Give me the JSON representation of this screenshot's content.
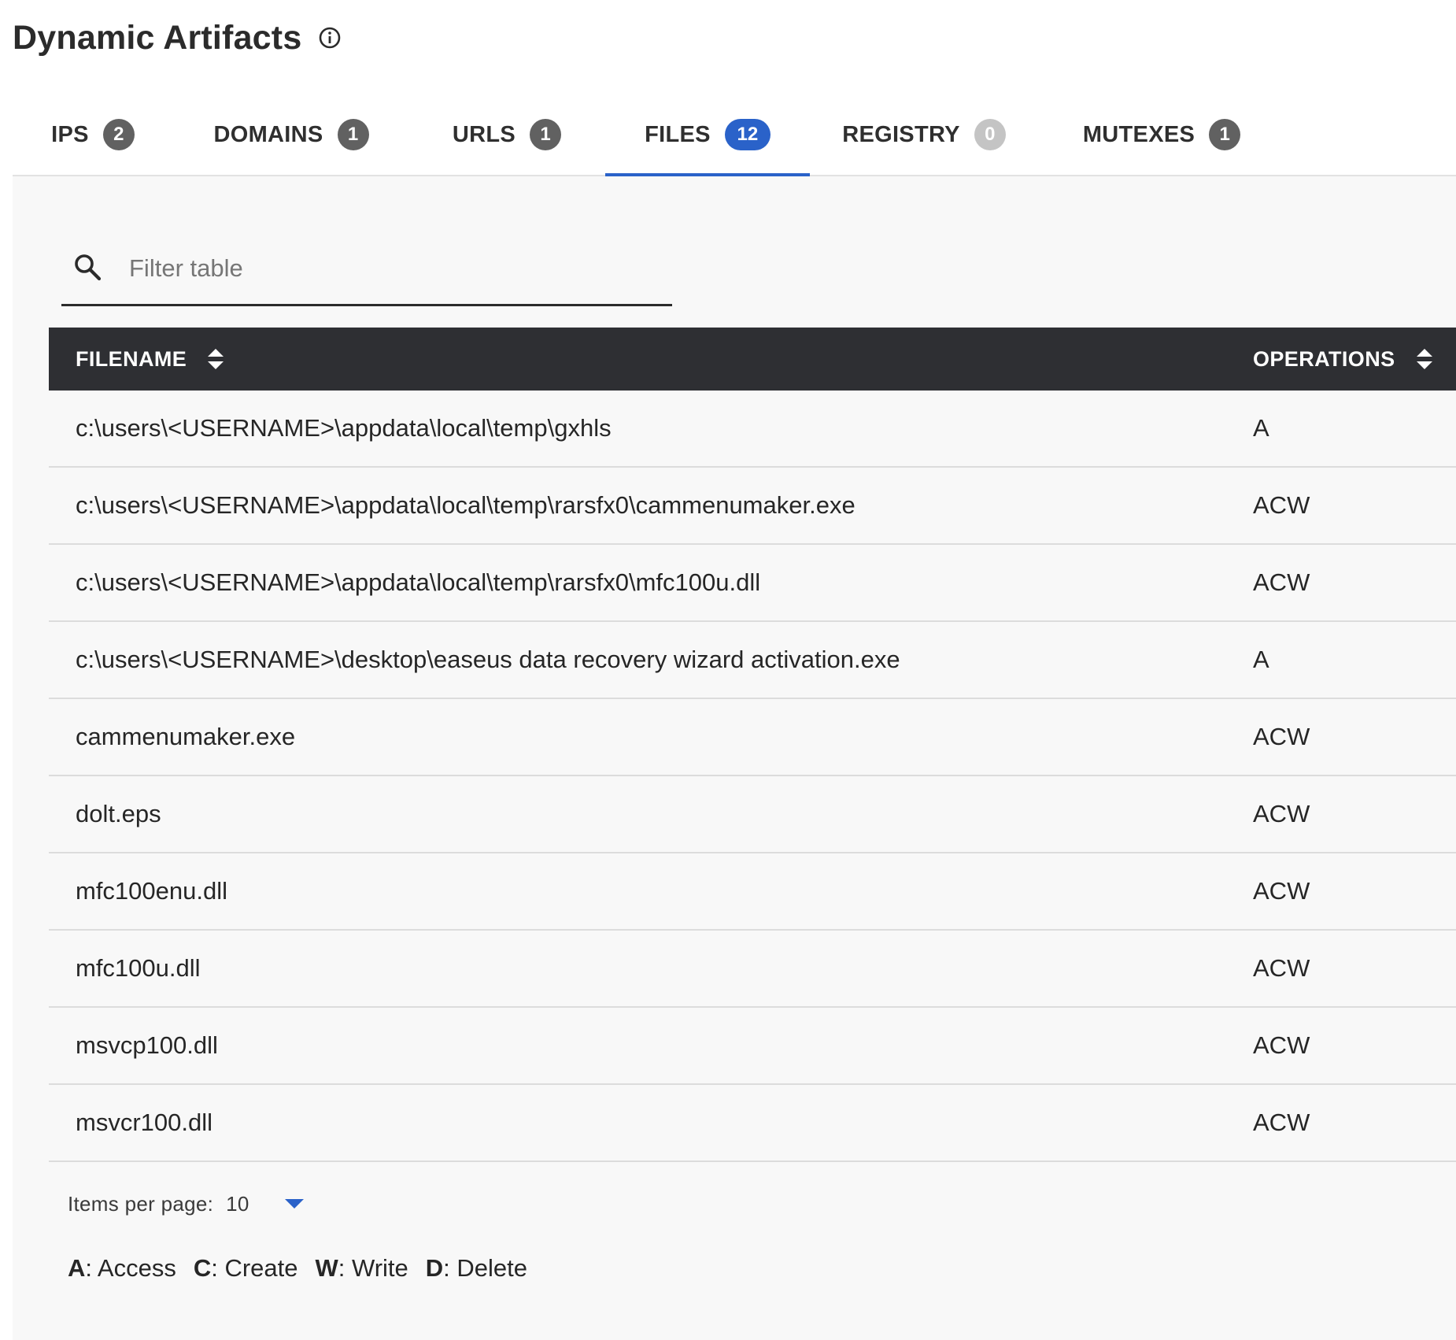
{
  "header": {
    "title": "Dynamic Artifacts",
    "info_icon": "info-icon"
  },
  "tabs": [
    {
      "label": "IPS",
      "count": "2"
    },
    {
      "label": "DOMAINS",
      "count": "1"
    },
    {
      "label": "URLS",
      "count": "1"
    },
    {
      "label": "FILES",
      "count": "12",
      "active": true
    },
    {
      "label": "REGISTRY",
      "count": "0"
    },
    {
      "label": "MUTEXES",
      "count": "1"
    }
  ],
  "filter": {
    "placeholder": "Filter table",
    "value": "",
    "icon": "search-icon"
  },
  "table": {
    "columns": [
      "FILENAME",
      "OPERATIONS"
    ],
    "rows": [
      {
        "filename": "c:\\users\\<USERNAME>\\appdata\\local\\temp\\gxhls",
        "operations": "A"
      },
      {
        "filename": "c:\\users\\<USERNAME>\\appdata\\local\\temp\\rarsfx0\\cammenumaker.exe",
        "operations": "ACW"
      },
      {
        "filename": "c:\\users\\<USERNAME>\\appdata\\local\\temp\\rarsfx0\\mfc100u.dll",
        "operations": "ACW"
      },
      {
        "filename": "c:\\users\\<USERNAME>\\desktop\\easeus data recovery wizard activation.exe",
        "operations": "A"
      },
      {
        "filename": "cammenumaker.exe",
        "operations": "ACW"
      },
      {
        "filename": "dolt.eps",
        "operations": "ACW"
      },
      {
        "filename": "mfc100enu.dll",
        "operations": "ACW"
      },
      {
        "filename": "mfc100u.dll",
        "operations": "ACW"
      },
      {
        "filename": "msvcp100.dll",
        "operations": "ACW"
      },
      {
        "filename": "msvcr100.dll",
        "operations": "ACW"
      }
    ]
  },
  "pagination": {
    "label": "Items per page:",
    "value": "10"
  },
  "legend": [
    {
      "key": "A",
      "text": "Access"
    },
    {
      "key": "C",
      "text": "Create"
    },
    {
      "key": "W",
      "text": "Write"
    },
    {
      "key": "D",
      "text": "Delete"
    }
  ],
  "colors": {
    "accent": "#2a62c9",
    "header_bg": "#2e2f33",
    "panel_bg": "#f8f8f8",
    "badge": "#616161",
    "badge_zero": "#c4c4c4"
  }
}
